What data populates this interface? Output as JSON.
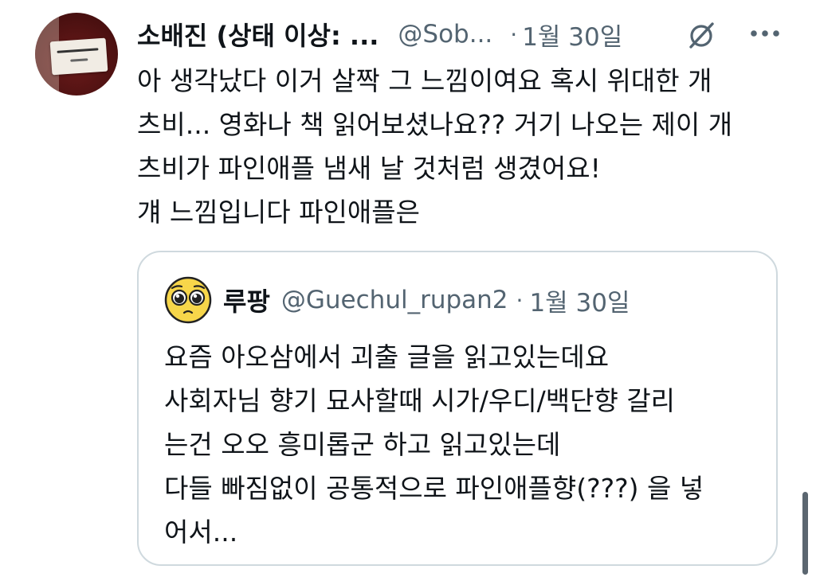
{
  "tweet": {
    "display_name": "소배진 (상태 이상: ...",
    "handle": "@Sob...",
    "separator": "·",
    "date": "1월 30일",
    "icons": {
      "grok": "grok-icon",
      "more": "more-icon"
    },
    "text_lines": [
      "아 생각났다 이거 살짝 그 느낌이여요 혹시 위대한 개",
      "츠비... 영화나 책 읽어보셨나요?? 거기 나오는 제이 개",
      "츠비가 파인애플 냄새 날 것처럼 생겼어요!",
      "걔 느낌입니다 파인애플은"
    ]
  },
  "quote": {
    "display_name": "루팡",
    "handle": "@Guechul_rupan2",
    "separator": "·",
    "date": "1월 30일",
    "text_lines": [
      "요즘 아오삼에서 괴출 글을 읽고있는데요",
      "사회자님 향기 묘사할때 시가/우디/백단향 갈리",
      "는건 오오 흥미롭군 하고 읽고있는데",
      "다들 빠짐없이 공통적으로 파인애플향(???) 을 넣",
      "어서..."
    ]
  },
  "colors": {
    "text_primary": "#0f1419",
    "text_secondary": "#536471",
    "border": "#cfd9de",
    "emoji_face": "#f7d64a"
  }
}
